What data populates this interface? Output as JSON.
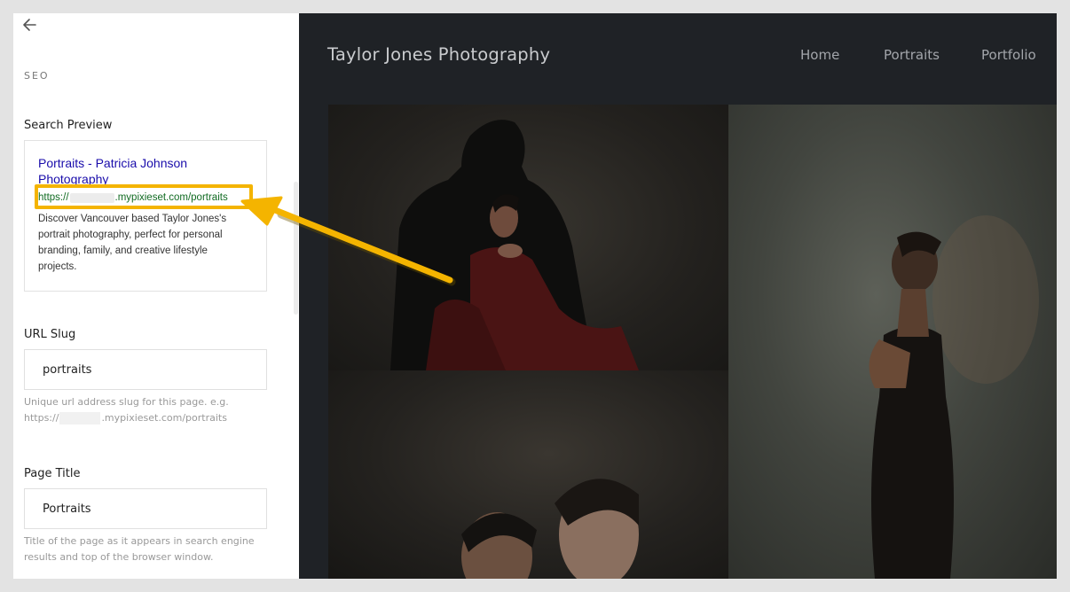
{
  "panel": {
    "section_label": "SEO",
    "search_preview": {
      "heading": "Search Preview",
      "title": "Portraits - Patricia Johnson Photography",
      "url_prefix": "https://",
      "url_suffix": ".mypixieset.com/portraits",
      "description": "Discover Vancouver based Taylor Jones's portrait photography, perfect for personal branding, family, and creative lifestyle projects."
    },
    "url_slug": {
      "heading": "URL Slug",
      "value": "portraits",
      "help_line1": "Unique url address slug for this page. e.g.",
      "help_prefix": "https://",
      "help_suffix": ".mypixieset.com/portraits"
    },
    "page_title": {
      "heading": "Page Title",
      "value": "Portraits",
      "help": "Title of the page as it appears in search engine results and top of the browser window."
    }
  },
  "site": {
    "title": "Taylor Jones Photography",
    "nav": [
      "Home",
      "Portraits",
      "Portfolio"
    ]
  },
  "colors": {
    "highlight": "#f4b400",
    "link_blue": "#1a0dab",
    "url_green": "#116b22",
    "site_bg": "#1f2226"
  }
}
